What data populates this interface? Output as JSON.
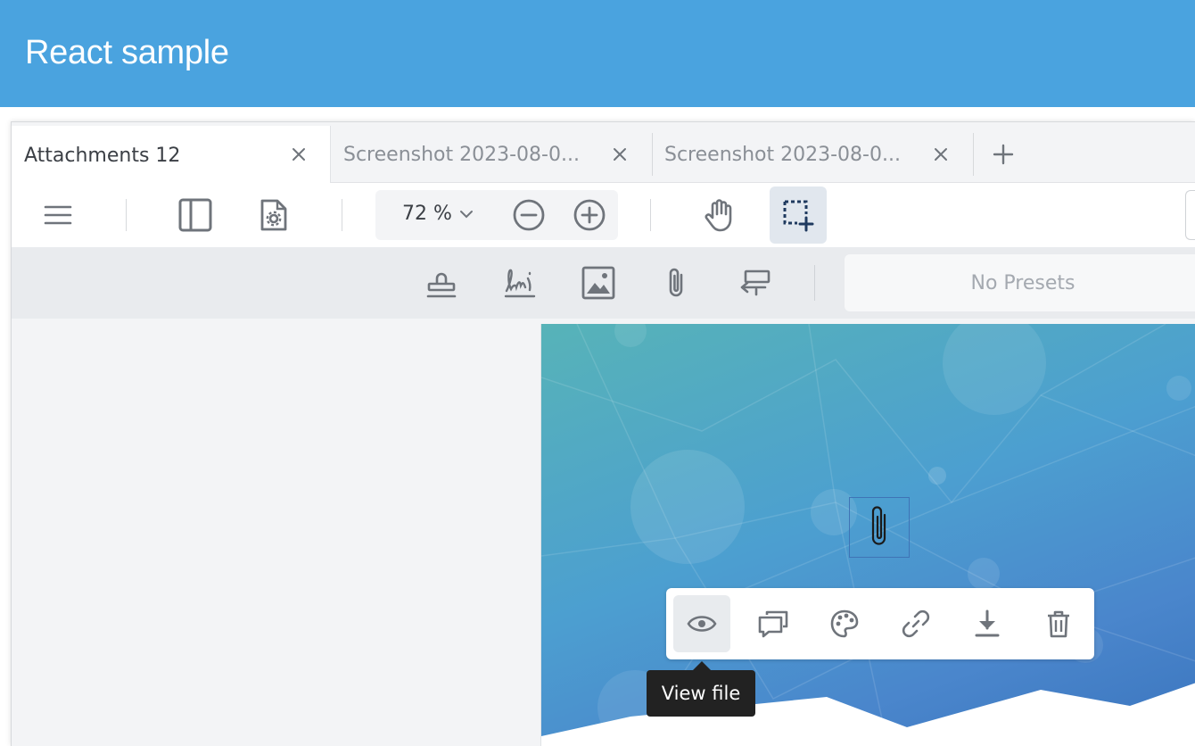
{
  "app": {
    "title": "React sample"
  },
  "tabs": [
    {
      "label": "Attachments 12",
      "active": true
    },
    {
      "label": "Screenshot 2023-08-0...",
      "active": false
    },
    {
      "label": "Screenshot 2023-08-0...",
      "active": false
    }
  ],
  "toolbar": {
    "zoom": {
      "value": "72 %"
    },
    "icons": [
      "menu-icon",
      "panel-icon",
      "file-settings-icon",
      "zoom-out-icon",
      "zoom-in-icon",
      "pan-hand-icon",
      "marquee-select-icon"
    ]
  },
  "annotation_toolbar": {
    "icons": [
      "stamp-icon",
      "signature-icon",
      "image-icon",
      "attachment-icon",
      "redact-icon"
    ],
    "presets_placeholder": "No Presets"
  },
  "attachment_popup": {
    "actions": [
      "eye-icon",
      "comment-icon",
      "palette-icon",
      "link-icon",
      "download-icon",
      "trash-icon"
    ],
    "tooltip": "View file"
  },
  "colors": {
    "header": "#4aa3df",
    "accent_selected": "#1f3a5f"
  }
}
